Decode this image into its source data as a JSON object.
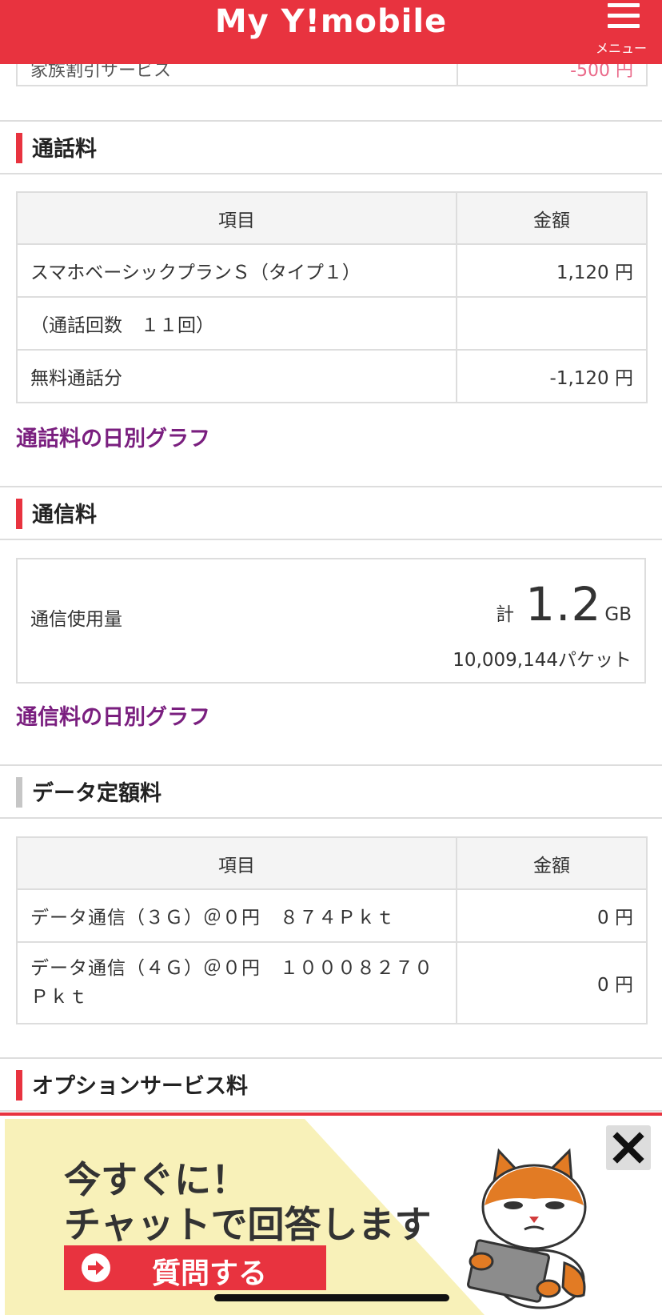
{
  "header": {
    "logo": "My Y!mobile",
    "menu_label": "メニュー"
  },
  "prev_row": {
    "label": "家族割引サービス",
    "price": "-500 円"
  },
  "call": {
    "title": "通話料",
    "col_item": "項目",
    "col_amount": "金額",
    "rows": [
      {
        "item": "スマホベーシックプランＳ（タイプ１）",
        "amount": "1,120 円"
      },
      {
        "item": "（通話回数　１１回）",
        "amount": ""
      },
      {
        "item": "無料通話分",
        "amount": "-1,120 円"
      }
    ],
    "graph_link": "通話料の日別グラフ"
  },
  "comm": {
    "title": "通信料",
    "usage_label": "通信使用量",
    "total_prefix": "計",
    "total_value": "1.2",
    "total_unit": "GB",
    "packets": "10,009,144パケット",
    "graph_link": "通信料の日別グラフ"
  },
  "data_flat": {
    "title": "データ定額料",
    "col_item": "項目",
    "col_amount": "金額",
    "rows": [
      {
        "item": "データ通信（３Ｇ）＠０円　８７４Ｐｋｔ",
        "amount": "0 円"
      },
      {
        "item": "データ通信（４Ｇ）＠０円　１０００８２７０Ｐｋｔ",
        "amount": "0 円"
      }
    ]
  },
  "options": {
    "title": "オプションサービス料"
  },
  "banner": {
    "line1": "今すぐに！",
    "line2": "チャットで回答します",
    "button_label": "質問する",
    "close_icon": "close-icon",
    "mascot": "cat-mascot-icon"
  },
  "colors": {
    "brand_red": "#e8333f",
    "link_purple": "#7a1f7f",
    "negative_pink": "#ea6a8a",
    "banner_yellow": "#f8f1b9"
  }
}
